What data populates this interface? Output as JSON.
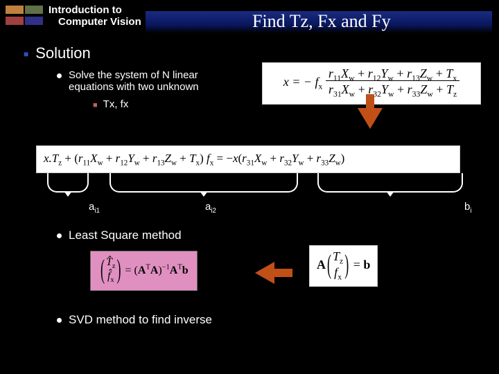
{
  "course": {
    "line1": "Introduction to",
    "line2": "Computer Vision"
  },
  "title": "Find Tz, Fx and Fy",
  "heading": "Solution",
  "bullet1": {
    "line1": "Solve the system of N linear",
    "line2": "equations with two unknown"
  },
  "sub1": "Tx, fx",
  "eq1": {
    "lead": "x = − f",
    "lead_sub": "x",
    "num": [
      "r",
      "11",
      "X",
      "w",
      " + r",
      "12",
      "Y",
      "w",
      " + r",
      "13",
      "Z",
      "w",
      " + T",
      "x"
    ],
    "den": [
      "r",
      "31",
      "X",
      "w",
      " + r",
      "32",
      "Y",
      "w",
      " + r",
      "33",
      "Z",
      "w",
      " + T",
      "z"
    ]
  },
  "eq2": {
    "parts": [
      "x.T",
      "z",
      " + (r",
      "11",
      "X",
      "w",
      " + r",
      "12",
      "Y",
      "w",
      " + r",
      "13",
      "Z",
      "w",
      " + T",
      "x",
      ") f",
      "x",
      " = −x(r",
      "31",
      "X",
      "w",
      " + r",
      "32",
      "Y",
      "w",
      " + r",
      "33",
      "Z",
      "w",
      ")"
    ]
  },
  "bracelabels": {
    "a1": "a",
    "a1sub": "i1",
    "a2": "a",
    "a2sub": "i2",
    "b": "b",
    "bsub": "i"
  },
  "bullet2": "Least Square method",
  "eq3": {
    "lhs_top": "T̂",
    "lhs_top_sub": "z",
    "lhs_bot": "f̂",
    "lhs_bot_sub": "x",
    "rhs": " = (A",
    "rhs_t": "T",
    "rhs2": "A)",
    "rhs_m1": "−1",
    "rhs3": " A",
    "rhs_t2": "T",
    "rhs4": "b"
  },
  "eq4": {
    "A": "A",
    "top": "T",
    "top_sub": "z",
    "bot": "f",
    "bot_sub": "x",
    "eq": " = b"
  },
  "bullet3": "SVD method to find inverse"
}
